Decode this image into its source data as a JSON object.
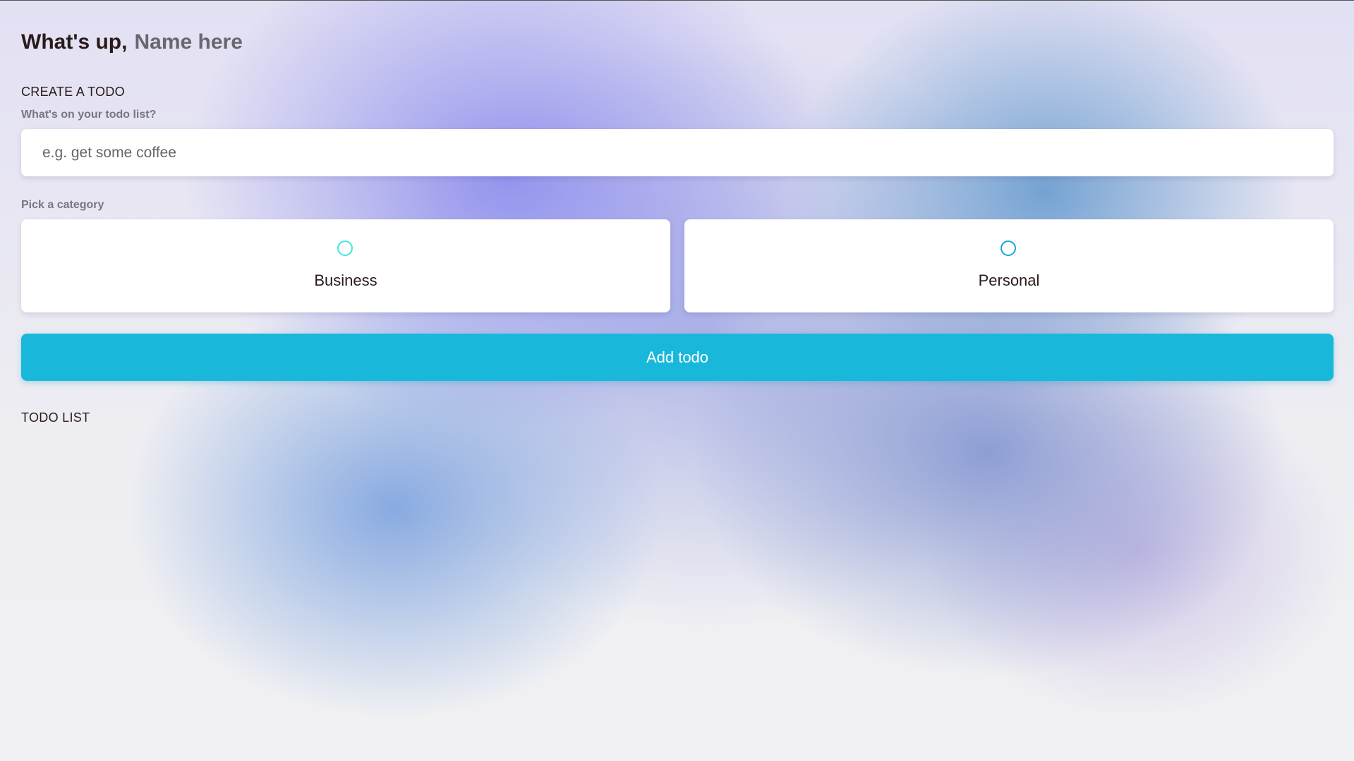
{
  "greeting": {
    "lead": "What's up,",
    "name": "Name here"
  },
  "create": {
    "title": "CREATE A TODO",
    "input_label": "What's on your todo list?",
    "input_placeholder": "e.g. get some coffee",
    "input_value": "",
    "category_label": "Pick a category",
    "categories": [
      {
        "label": "Business",
        "color": "#3ee8d8",
        "selected": false
      },
      {
        "label": "Personal",
        "color": "#17a9cc",
        "selected": false
      }
    ],
    "submit_label": "Add todo"
  },
  "list": {
    "title": "TODO LIST",
    "items": []
  },
  "colors": {
    "accent": "#19b8db",
    "text": "#2a1a1a",
    "muted": "#7a7680"
  }
}
